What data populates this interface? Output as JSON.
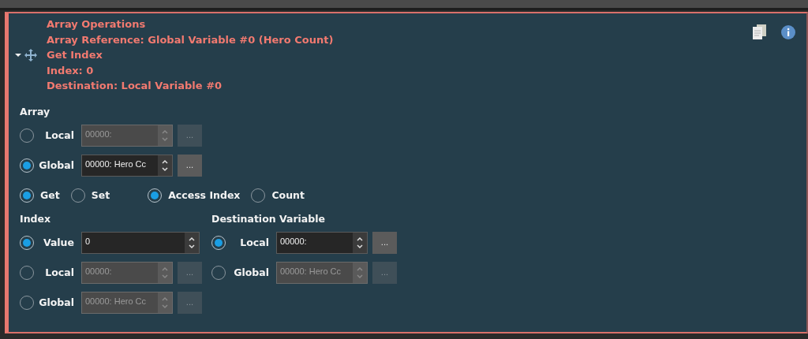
{
  "header": {
    "lines": [
      {
        "text": "Array Operations",
        "kind": "plain"
      },
      {
        "text": "Array Reference: Global Variable #0 (Hero Count)",
        "kind": "plain"
      },
      {
        "text": "Get Index",
        "kind": "node",
        "expanded": true
      },
      {
        "text": "Index: 0",
        "kind": "plain"
      },
      {
        "text": "Destination: Local Variable #0",
        "kind": "plain"
      }
    ]
  },
  "array": {
    "heading": "Array",
    "rows": [
      {
        "kind": "picker",
        "label": "Local",
        "selected": false,
        "disabled": true,
        "value": "00000:",
        "button": "..."
      },
      {
        "kind": "picker",
        "label": "Global",
        "selected": true,
        "disabled": false,
        "value": "00000: Hero Cc",
        "button": "..."
      }
    ]
  },
  "modes": [
    [
      {
        "label": "Get",
        "selected": true
      },
      {
        "label": "Set",
        "selected": false
      }
    ],
    [
      {
        "label": "Access Index",
        "selected": true
      },
      {
        "label": "Count",
        "selected": false
      }
    ]
  ],
  "index": {
    "heading": "Index",
    "rows": [
      {
        "kind": "number",
        "label": "Value",
        "selected": true,
        "disabled": false,
        "value": "0"
      },
      {
        "kind": "picker",
        "label": "Local",
        "selected": false,
        "disabled": true,
        "value": "00000:",
        "button": "..."
      },
      {
        "kind": "picker",
        "label": "Global",
        "selected": false,
        "disabled": true,
        "value": "00000: Hero Cc",
        "button": "..."
      }
    ]
  },
  "destination": {
    "heading": "Destination Variable",
    "rows": [
      {
        "kind": "picker",
        "label": "Local",
        "selected": true,
        "disabled": false,
        "value": "00000:",
        "button": "..."
      },
      {
        "kind": "picker",
        "label": "Global",
        "selected": false,
        "disabled": true,
        "value": "00000: Hero Cc",
        "button": "..."
      }
    ]
  }
}
